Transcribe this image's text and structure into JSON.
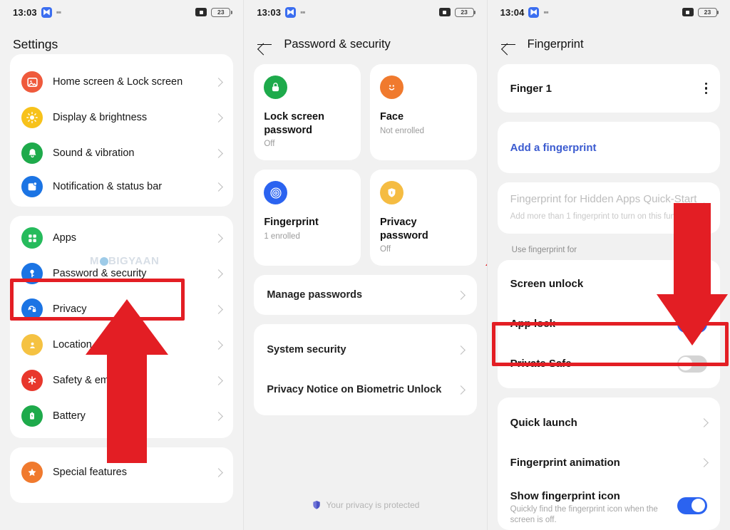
{
  "meta": {
    "accent_blue": "#2b63f0",
    "annotation_red": "#e31e24",
    "watermark_text_left": "M",
    "watermark_text_right": "BIGYAAN"
  },
  "panel1": {
    "statusbar": {
      "time": "13:03",
      "battery": "23"
    },
    "header": {
      "title": "Settings"
    },
    "group_display": {
      "items": [
        {
          "label": "Home screen & Lock screen",
          "icon": "photo-icon",
          "color": "#ef5a3c"
        },
        {
          "label": "Display & brightness",
          "icon": "sun-icon",
          "color": "#f7c21b"
        },
        {
          "label": "Sound & vibration",
          "icon": "bell-icon",
          "color": "#1eaa4b"
        },
        {
          "label": "Notification & status bar",
          "icon": "notification-icon",
          "color": "#1b74e4"
        }
      ]
    },
    "group_security": {
      "items": [
        {
          "label": "Apps",
          "icon": "apps-grid-icon",
          "color": "#26bb5c"
        },
        {
          "label": "Password & security",
          "icon": "key-icon",
          "color": "#1b74e4"
        },
        {
          "label": "Privacy",
          "icon": "privacy-hand-icon",
          "color": "#1b74e4"
        },
        {
          "label": "Location",
          "icon": "location-icon",
          "color": "#f5c242"
        },
        {
          "label": "Safety & emergency",
          "icon": "emergency-icon",
          "color": "#e8372c"
        },
        {
          "label": "Battery",
          "icon": "battery-icon",
          "color": "#1eaa4b"
        }
      ]
    },
    "group_special": {
      "items": [
        {
          "label": "Special features",
          "icon": "star-icon",
          "color": "#f07a2e"
        }
      ]
    }
  },
  "panel2": {
    "statusbar": {
      "time": "13:03",
      "battery": "23"
    },
    "header": {
      "title": "Password & security"
    },
    "tiles": [
      {
        "name": "Lock screen password",
        "status": "Off",
        "icon": "lock-icon",
        "color": "#1eaa4b"
      },
      {
        "name": "Face",
        "status": "Not enrolled",
        "icon": "face-icon",
        "color": "#f07a2e"
      },
      {
        "name": "Fingerprint",
        "status": "1 enrolled",
        "icon": "fingerprint-icon",
        "color": "#2b63f0"
      },
      {
        "name": "Privacy password",
        "status": "Off",
        "icon": "shield-icon",
        "color": "#f5bc42"
      }
    ],
    "group_manage": {
      "items": [
        {
          "label": "Manage passwords"
        }
      ]
    },
    "group_system": {
      "items": [
        {
          "label": "System security"
        },
        {
          "label": "Privacy Notice on Biometric Unlock"
        }
      ]
    },
    "footer": {
      "text": "Your privacy is protected",
      "icon": "shield-check-icon"
    }
  },
  "panel3": {
    "statusbar": {
      "time": "13:04",
      "battery": "23"
    },
    "header": {
      "title": "Fingerprint"
    },
    "finger_item": {
      "label": "Finger 1",
      "menu_icon": "kebab-menu-icon"
    },
    "add_fingerprint": {
      "label": "Add a fingerprint"
    },
    "hidden_apps": {
      "title": "Fingerprint for Hidden Apps Quick-Start",
      "subtitle": "Add more than 1 fingerprint to turn on this function."
    },
    "use_fingerprint_caption": "Use fingerprint for",
    "use_fingerprint_items": [
      {
        "label": "Screen unlock",
        "toggle": "on"
      },
      {
        "label": "App lock",
        "toggle": "on"
      },
      {
        "label": "Private Safe",
        "toggle": "off"
      }
    ],
    "more_items": [
      {
        "label": "Quick launch",
        "type": "chevron"
      },
      {
        "label": "Fingerprint animation",
        "type": "chevron"
      },
      {
        "label": "Show fingerprint icon",
        "sub": "Quickly find the fingerprint icon when the screen is off.",
        "type": "toggle",
        "toggle": "on"
      }
    ]
  }
}
